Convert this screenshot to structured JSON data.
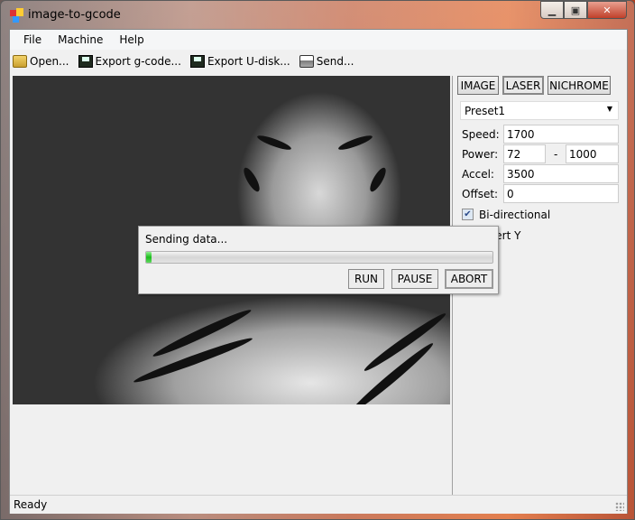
{
  "window": {
    "title": "image-to-gcode",
    "minimize_icon": "minimize-icon",
    "maximize_icon": "maximize-icon",
    "close_icon": "close-icon"
  },
  "menu": {
    "items": [
      {
        "label": "File"
      },
      {
        "label": "Machine"
      },
      {
        "label": "Help"
      }
    ]
  },
  "toolbar": {
    "items": [
      {
        "label": "Open...",
        "icon": "folder-open-icon"
      },
      {
        "label": "Export g-code...",
        "icon": "floppy-disk-icon"
      },
      {
        "label": "Export U-disk...",
        "icon": "floppy-disk-icon"
      },
      {
        "label": "Send...",
        "icon": "printer-icon"
      }
    ]
  },
  "right_panel": {
    "tabs": [
      {
        "label": "IMAGE"
      },
      {
        "label": "LASER",
        "selected": true
      },
      {
        "label": "NICHROME"
      }
    ],
    "preset": {
      "value": "Preset1"
    },
    "speed": {
      "label": "Speed:",
      "value": "1700"
    },
    "power": {
      "label": "Power:",
      "min": "72",
      "separator": "-",
      "max": "1000"
    },
    "accel": {
      "label": "Accel:",
      "value": "3500"
    },
    "offset": {
      "label": "Offset:",
      "value": "0"
    },
    "bidirectional": {
      "label": "Bi-directional",
      "checked": true
    },
    "invert_y": {
      "label": "Invert Y"
    }
  },
  "dialog": {
    "message": "Sending data...",
    "progress_percent": 1,
    "run": "RUN",
    "pause": "PAUSE",
    "abort": "ABORT",
    "accent": "#1cbc1c"
  },
  "status": {
    "text": "Ready"
  }
}
